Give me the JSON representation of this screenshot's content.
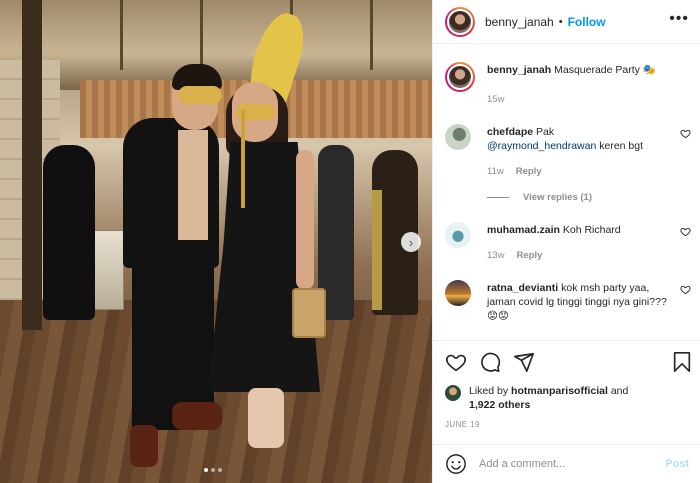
{
  "post": {
    "author": "benny_janah",
    "follow_label": "Follow",
    "separator": "•",
    "caption_text": "Masquerade Party 🎭",
    "caption_age": "15w",
    "likes": {
      "prefix": "Liked by",
      "user": "hotmanparisofficial",
      "joiner": "and",
      "others": "1,922 others"
    },
    "date": "JUNE 19",
    "carousel": {
      "current": 1,
      "total": 3
    }
  },
  "comments": [
    {
      "user": "chefdape",
      "text_before": "Pak",
      "mention": "@raymond_hendrawan",
      "text_after": "keren bgt",
      "age": "11w",
      "reply_label": "Reply",
      "view_replies": "View replies (1)"
    },
    {
      "user": "muhamad.zain",
      "text": "Koh Richard",
      "age": "13w",
      "reply_label": "Reply"
    },
    {
      "user": "ratna_devianti",
      "text": "kok msh party yaa, jaman covid lg tinggi tinggi nya gini??? 😟😟",
      "age": "",
      "reply_label": ""
    }
  ],
  "composer": {
    "placeholder": "Add a comment...",
    "post_label": "Post"
  },
  "icons": {
    "more": "more-options-icon",
    "like": "heart-icon",
    "comment": "comment-bubble-icon",
    "share": "paper-plane-icon",
    "save": "bookmark-icon",
    "emoji": "emoji-smiley-icon",
    "next": "chevron-right-icon"
  },
  "colors": {
    "link_blue": "#0095f6",
    "muted": "#8e8e8e",
    "text": "#262626",
    "post_disabled": "#b2dffc"
  }
}
